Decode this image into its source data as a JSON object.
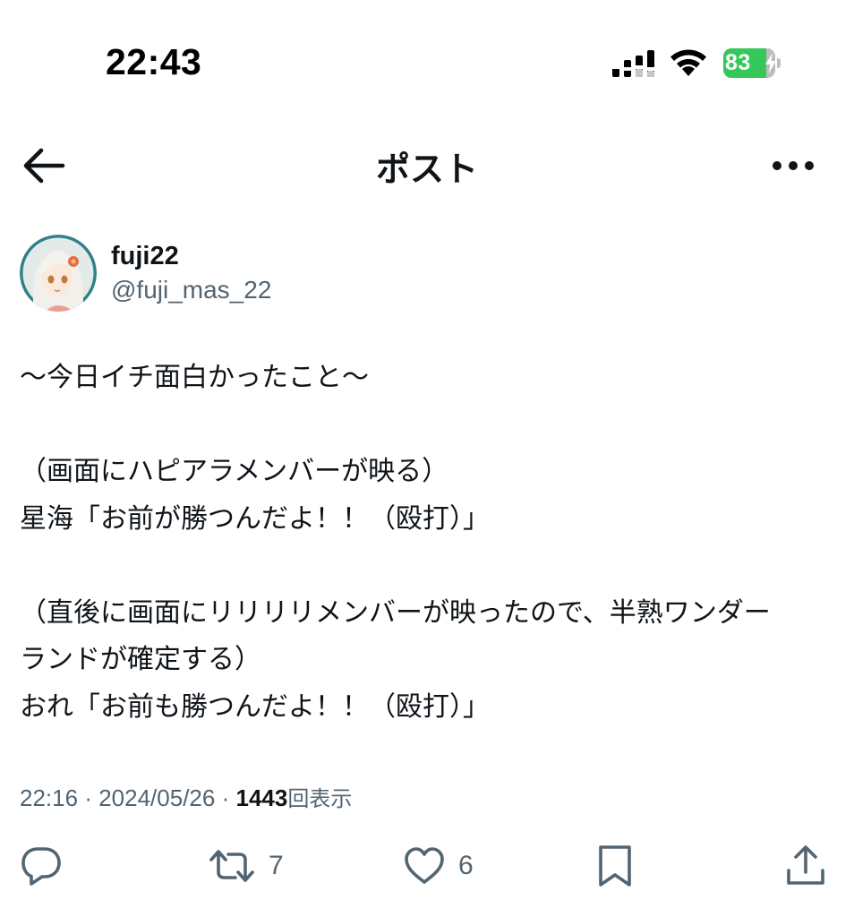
{
  "status_bar": {
    "time": "22:43",
    "battery": "83",
    "battery_color": "#35c759"
  },
  "nav": {
    "title": "ポスト",
    "back_icon": "arrow-left-icon",
    "more_icon": "more-horizontal-icon"
  },
  "author": {
    "display_name": "fuji22",
    "handle": "@fuji_mas_22"
  },
  "post": {
    "lines": [
      "〜今日イチ面白かったこと〜",
      "",
      "（画面にハピアラメンバーが映る）",
      "星海「お前が勝つんだよ！！（殴打）」",
      "",
      "（直後に画面にリリリリメンバーが映ったので、半熟ワンダー",
      "ランドが確定する）",
      "おれ「お前も勝つんだよ！！（殴打）」"
    ]
  },
  "meta": {
    "time": "22:16",
    "separator": "·",
    "date": "2024/05/26",
    "views_count": "1443",
    "views_label": "回表示"
  },
  "actions": {
    "reply_icon": "reply-bubble-icon",
    "repost_icon": "repost-icon",
    "repost_count": "7",
    "like_icon": "heart-icon",
    "like_count": "6",
    "bookmark_icon": "bookmark-icon",
    "share_icon": "share-icon"
  },
  "colors": {
    "text_primary": "#0f1419",
    "text_secondary": "#536471"
  }
}
